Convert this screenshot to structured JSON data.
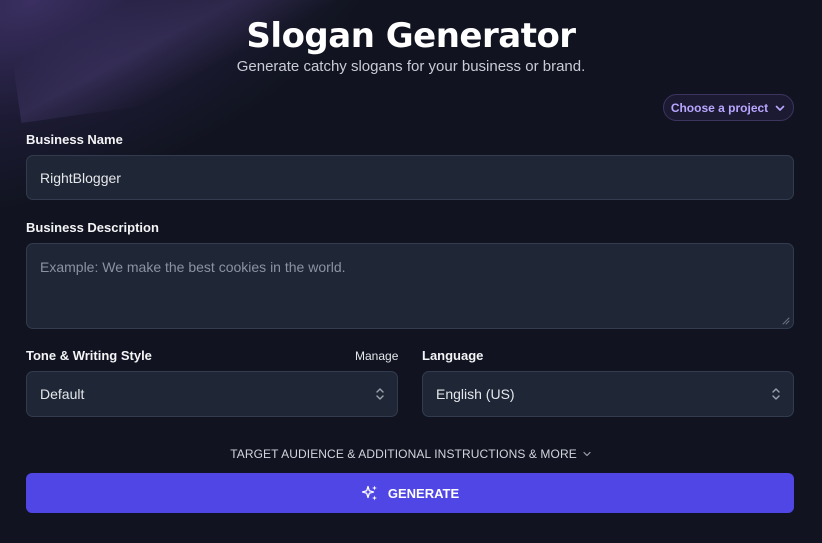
{
  "header": {
    "title": "Slogan Generator",
    "subtitle": "Generate catchy slogans for your business or brand."
  },
  "project_selector": {
    "label": "Choose a project",
    "icon": "chevron-down-icon"
  },
  "business_name": {
    "label": "Business Name",
    "value": "RightBlogger"
  },
  "business_description": {
    "label": "Business Description",
    "placeholder": "Example: We make the best cookies in the world."
  },
  "tone": {
    "label": "Tone & Writing Style",
    "manage_label": "Manage",
    "selected": "Default",
    "icon": "updown-chevron-icon"
  },
  "language": {
    "label": "Language",
    "selected": "English (US)",
    "icon": "updown-chevron-icon"
  },
  "more_options": {
    "label": "TARGET AUDIENCE & ADDITIONAL INSTRUCTIONS & MORE",
    "icon": "chevron-down-icon"
  },
  "generate": {
    "label": "GENERATE",
    "icon": "sparkles-icon"
  },
  "colors": {
    "background": "#111420",
    "accent": "#4f46e5",
    "field_bg": "#1f2736",
    "project_text": "#b9a6ff"
  }
}
